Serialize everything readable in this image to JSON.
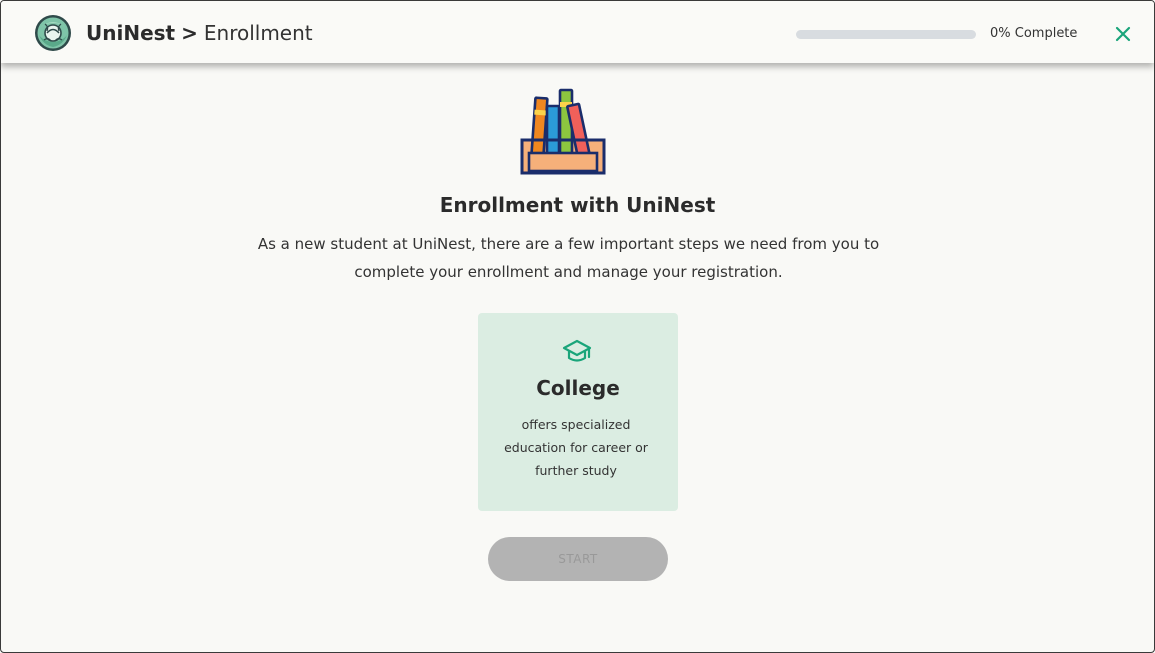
{
  "header": {
    "brand_name": "UniNest",
    "separator": ">",
    "section": "Enrollment",
    "logo_icon": "cabbage-logo-icon",
    "progress": {
      "percent": 0,
      "label": "0% Complete"
    },
    "close_icon": "close-icon"
  },
  "main": {
    "hero_icon": "books-icon",
    "title": "Enrollment with UniNest",
    "intro": "As a new student at UniNest, there are a few important steps we need from you to complete your enrollment and manage your registration.",
    "card": {
      "icon": "graduation-cap-icon",
      "title": "College",
      "description": "offers specialized education for career or further study"
    },
    "start_label": "START"
  },
  "colors": {
    "accent": "#1aa57a",
    "card_bg": "#dbede2",
    "button_disabled_bg": "#b3b3b3",
    "progress_track": "#d8dce0",
    "page_bg": "#f9f9f6"
  }
}
